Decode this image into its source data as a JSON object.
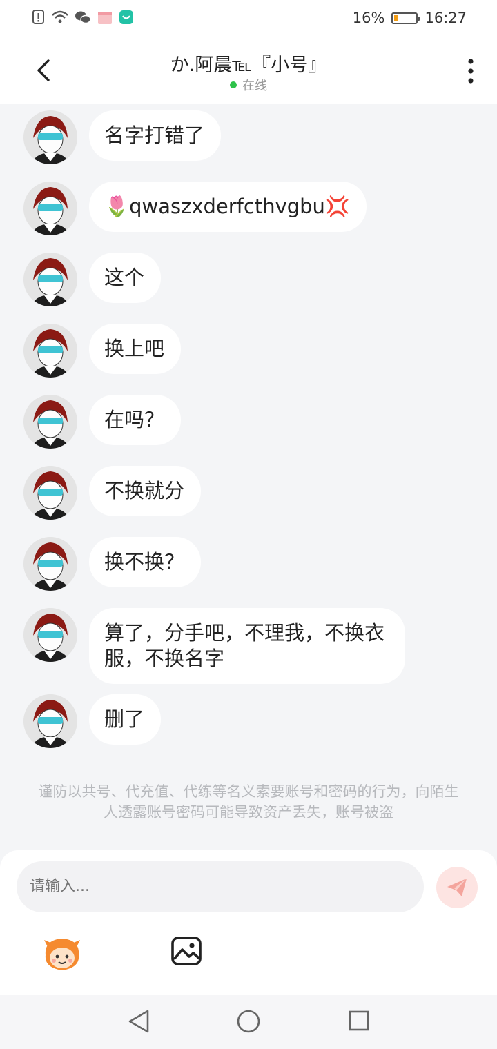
{
  "status_bar": {
    "battery_percent": "16%",
    "time": "16:27",
    "icons": [
      "alert-icon",
      "wifi-icon",
      "wechat-icon",
      "gift-icon",
      "app-notification-icon"
    ]
  },
  "header": {
    "title": "か.阿晨℡『小号』",
    "online_status": "在线"
  },
  "messages": [
    {
      "text": "名字打错了"
    },
    {
      "text": "🌷qwaszxderfcthvgbu💢"
    },
    {
      "text": "这个"
    },
    {
      "text": "换上吧"
    },
    {
      "text": "在吗？"
    },
    {
      "text": "不换就分"
    },
    {
      "text": "换不换？"
    },
    {
      "text": "算了，分手吧，不理我，不换衣服，不换名字"
    },
    {
      "text": "删了"
    }
  ],
  "warning": "谨防以共号、代充值、代练等名义索要账号和密码的行为，向陌生人透露账号密码可能导致资产丢失，账号被盗",
  "input": {
    "placeholder": "请输入..."
  },
  "colors": {
    "online": "#2ec24a",
    "send_bg": "#fde4e2",
    "send_icon": "#f4a49c",
    "page_bg": "#f4f5f7"
  }
}
